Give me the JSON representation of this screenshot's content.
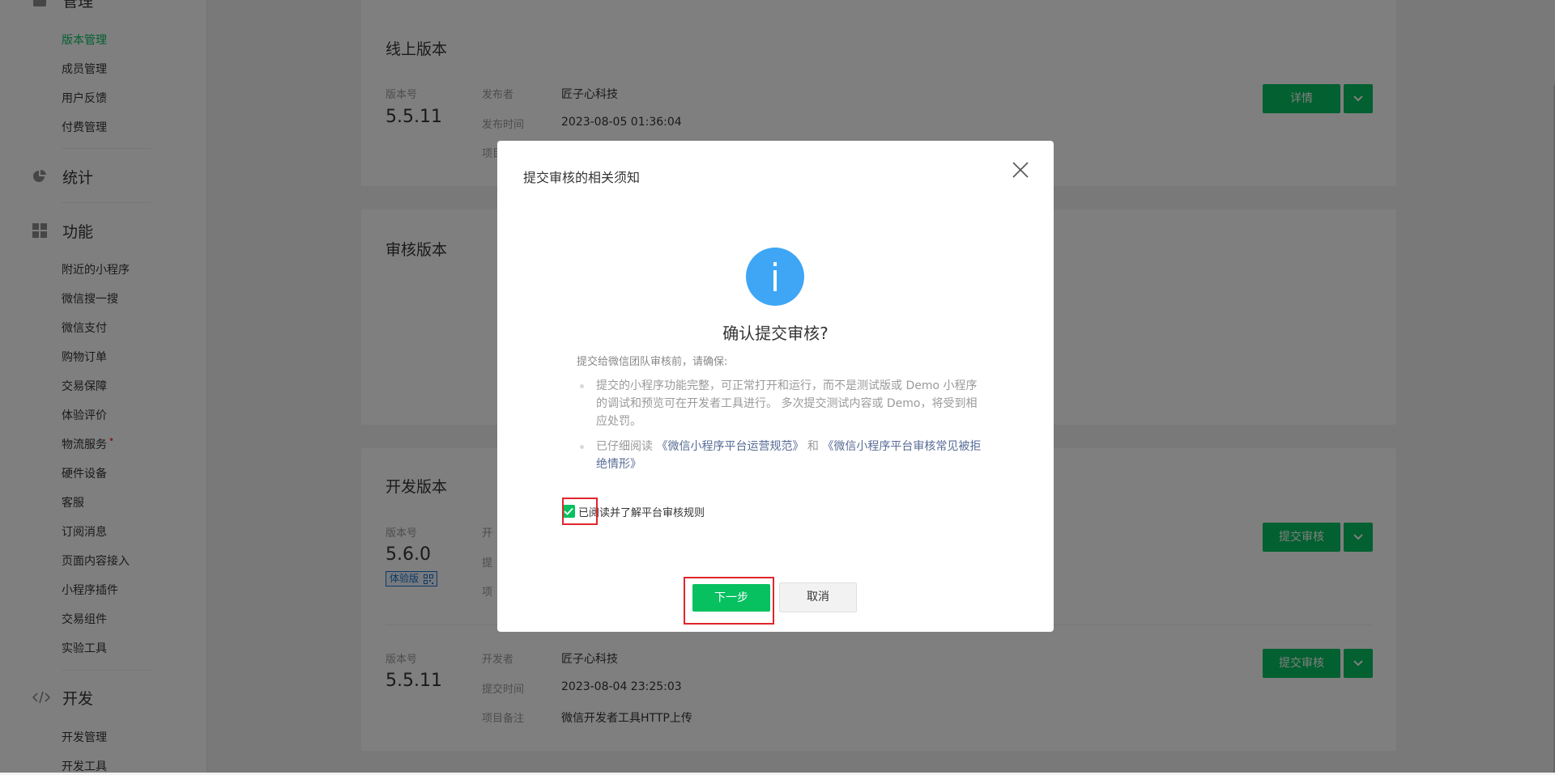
{
  "sidebar": {
    "groups": {
      "manage": "管理",
      "stats": "统计",
      "features": "功能",
      "dev": "开发"
    },
    "manage_items": [
      "版本管理",
      "成员管理",
      "用户反馈",
      "付费管理"
    ],
    "feature_items": [
      "附近的小程序",
      "微信搜一搜",
      "微信支付",
      "购物订单",
      "交易保障",
      "体验评价",
      "物流服务",
      "硬件设备",
      "客服",
      "订阅消息",
      "页面内容接入",
      "小程序插件",
      "交易组件",
      "实验工具"
    ],
    "dev_items": [
      "开发管理",
      "开发工具"
    ],
    "active_item": "版本管理",
    "badge_item": "物流服务"
  },
  "online": {
    "title": "线上版本",
    "version_label": "版本号",
    "version": "5.5.11",
    "publisher_label": "发布者",
    "publisher": "匠子心科技",
    "time_label": "发布时间",
    "time": "2023-08-05 01:36:04",
    "note_label": "项目",
    "detail_button": "详情"
  },
  "review": {
    "title": "审核版本"
  },
  "dev": {
    "title": "开发版本",
    "row1": {
      "version_label": "版本号",
      "version": "5.6.0",
      "tag": "体验版",
      "lbl1": "开",
      "lbl2": "提",
      "lbl3": "项",
      "submit_button": "提交审核"
    },
    "row2": {
      "version_label": "版本号",
      "version": "5.5.11",
      "dev_label": "开发者",
      "developer": "匠子心科技",
      "time_label": "提交时间",
      "time": "2023-08-04 23:25:03",
      "note_label": "项目备注",
      "note": "微信开发者工具HTTP上传",
      "submit_button": "提交审核"
    }
  },
  "dialog": {
    "title": "提交审核的相关须知",
    "heading": "确认提交审核?",
    "intro": "提交给微信团队审核前，请确保:",
    "bullet1": "提交的小程序功能完整，可正常打开和运行，而不是测试版或 Demo 小程序的调试和预览可在开发者工具进行。 多次提交测试内容或 Demo，将受到相应处罚。",
    "bullet2_prefix": "已仔细阅读",
    "link1": "《微信小程序平台运营规范》",
    "bullet2_and": "和",
    "link2": "《微信小程序平台审核常见被拒绝情形》",
    "agree": "已阅读并了解平台审核规则",
    "agree_checked": true,
    "next_button": "下一步",
    "cancel_button": "取消"
  },
  "colors": {
    "brand": "#07c160",
    "info": "#3ea6f5",
    "link": "#576b95",
    "highlight": "#e0262c"
  }
}
